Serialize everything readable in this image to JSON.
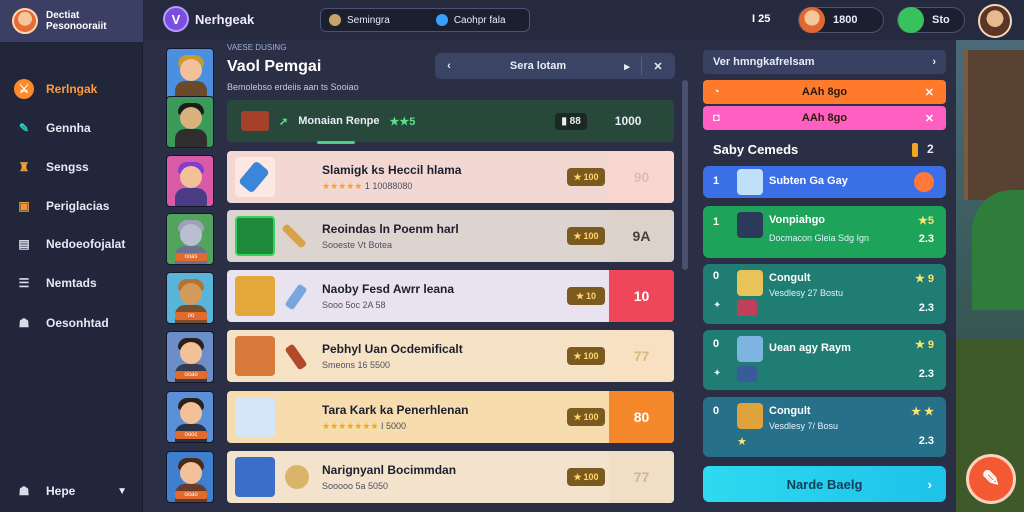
{
  "brand": {
    "line1": "Dectiat",
    "line2": "Pesonooraiit"
  },
  "app": {
    "logo_letter": "V",
    "title": "Nerhgeak"
  },
  "search": {
    "left": "Semingra",
    "right": "Caohpr fala"
  },
  "top": {
    "counter": "I 25",
    "coins_a": "1800",
    "coins_b": "Sto"
  },
  "sidebar": {
    "items": [
      {
        "label": "Rerlngak",
        "icon": "sword-icon",
        "color": "#ff8a2a"
      },
      {
        "label": "Gennha",
        "icon": "pin-icon",
        "color": "#2ad0c4"
      },
      {
        "label": "Sengss",
        "icon": "bag-icon",
        "color": "#f0a040"
      },
      {
        "label": "Periglacias",
        "icon": "chest-icon",
        "color": "#e8973a"
      },
      {
        "label": "Nedoeofojalat",
        "icon": "card-icon",
        "color": "#d8dbe8"
      },
      {
        "label": "Nemtads",
        "icon": "list-icon",
        "color": "#d8dbe8"
      },
      {
        "label": "Oesonhtad",
        "icon": "people-icon",
        "color": "#d8dbe8"
      }
    ],
    "footer": {
      "label": "Hepe",
      "icon": "people-icon"
    }
  },
  "middle": {
    "subtitle": "VAESE DUSING",
    "title": "Vaol Pemgai",
    "desc": "Bemolebso erdeiis aan ts Sooiao",
    "tabs": {
      "mid_label": "Sera lotam"
    },
    "feature": {
      "label": "Monaian Renpe",
      "stars": "★★5",
      "tag": "88",
      "score": "1000"
    },
    "rows": [
      {
        "name": "Slamigk ks Heccil hlama",
        "stars": "★★★★★",
        "meta": "1 10088080",
        "rank": "100",
        "score": "90",
        "bg": "#f3d7d2",
        "score_bg": "#f7d7d0",
        "score_color": "#e7b9ae"
      },
      {
        "name": "Reoindas ln Poenm harl",
        "stars": "",
        "meta": "Sooeste Vt Botea",
        "rank": "100",
        "score": "9A",
        "bg": "#ddd4cf",
        "score_bg": "#ddd1cc",
        "score_color": "#4a3f3a"
      },
      {
        "name": "Naoby Fesd Awrr leana",
        "stars": "",
        "meta": "Sooo 5oc 2A 58",
        "rank": "10",
        "score": "10",
        "bg": "#e9e2ef",
        "score_bg": "#f0465a",
        "score_color": "#ffffff"
      },
      {
        "name": "Pebhyl Uan Ocdemificalt",
        "stars": "",
        "meta": "Smeons 16 5500",
        "rank": "100",
        "score": "77",
        "bg": "#f6e3c6",
        "score_bg": "#f7e1c2",
        "score_color": "#d9b685"
      },
      {
        "name": "Tara Kark ka Penerhlenan",
        "stars": "★★★★★★★",
        "meta": "I 5000",
        "rank": "100",
        "score": "80",
        "bg": "#f7dcae",
        "score_bg": "#f5882a",
        "score_color": "#ffffff"
      },
      {
        "name": "Narignyanl Bocimmdan",
        "stars": "",
        "meta": "Sooooo 5a 5050",
        "rank": "100",
        "score": "77",
        "bg": "#f3e3cc",
        "score_bg": "#f1dec6",
        "score_color": "#d0b697"
      }
    ]
  },
  "right": {
    "header": "Ver hmngkafrelsam",
    "btn1": "AAh 8go",
    "btn2": "AAh 8go",
    "section": "Saby Cemeds",
    "section_count": "2",
    "cards": [
      {
        "idx": "1",
        "name": "Subten Ga Gay",
        "sub": "",
        "num": "",
        "bg": "#3b6fe8"
      },
      {
        "idx": "1",
        "name": "Vonpiahgo",
        "sub": "Docmacon Gleia Sdg Ign",
        "num": "★5",
        "num2": "2.3",
        "bg": "#1ea35a"
      },
      {
        "idx": "0",
        "name": "Congult",
        "sub": "Vesdlesy 27 Bostu",
        "num": "★ 9",
        "num2": "2.3",
        "bg": "#1f7d74"
      },
      {
        "idx": "0",
        "name": "Uean agy Raym",
        "sub": "",
        "num": "★ 9",
        "num2": "2.3",
        "bg": "#1f7d74"
      },
      {
        "idx": "0",
        "name": "Congult",
        "sub": "Vesdlesy 7/ Bosu",
        "num": "★ ★",
        "num2": "2.3",
        "bg": "#26708a"
      }
    ],
    "cta": "Narde Baelg"
  },
  "colors": {
    "accent": "#ff9b3d",
    "panel": "#2b2f45",
    "sidebar": "#22263a"
  }
}
